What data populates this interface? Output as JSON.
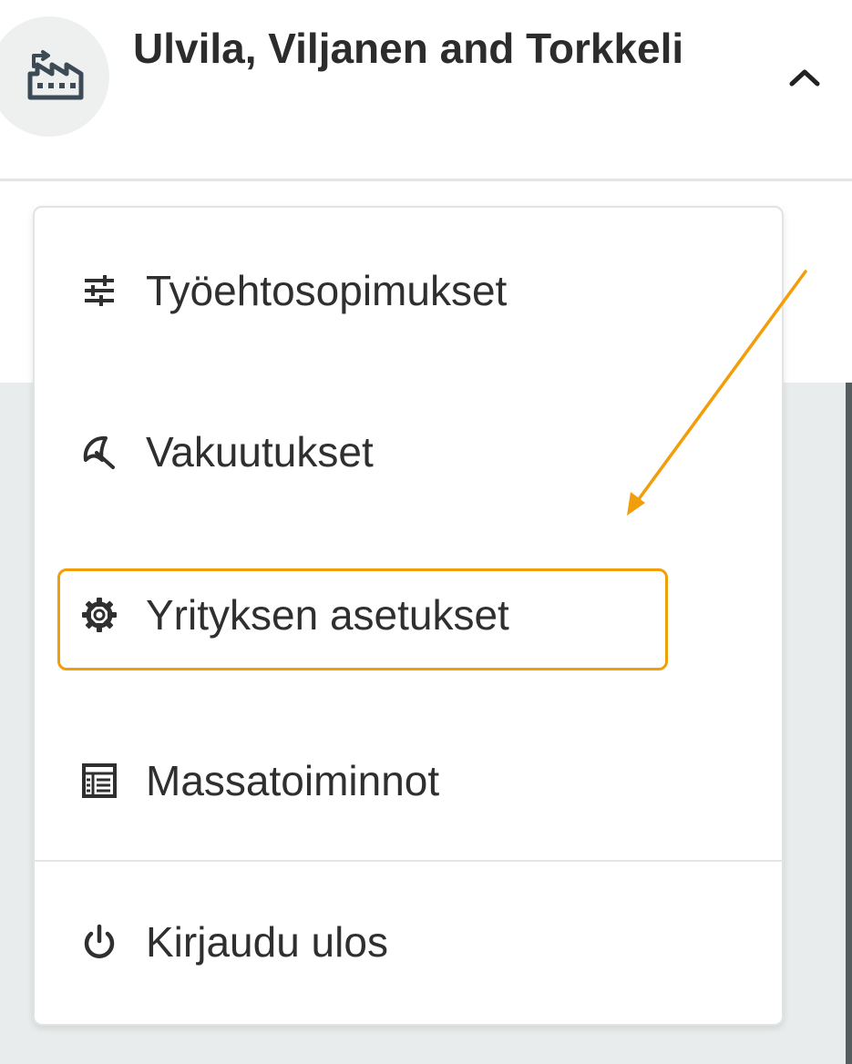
{
  "header": {
    "company_name": "Ulvila, Viljanen and Torkkeli",
    "company_icon": "factory-icon",
    "toggle_icon": "chevron-up-icon"
  },
  "menu": {
    "items": [
      {
        "label": "Työehtosopimukset",
        "icon": "sliders-icon"
      },
      {
        "label": "Vakuutukset",
        "icon": "umbrella-icon"
      },
      {
        "label": "Yrityksen asetukset",
        "icon": "gear-icon",
        "highlighted": true
      },
      {
        "label": "Massatoiminnot",
        "icon": "table-icon"
      }
    ],
    "logout": {
      "label": "Kirjaudu ulos",
      "icon": "power-icon"
    }
  },
  "annotation": {
    "color": "#f29d0a",
    "target": "Yrityksen asetukset"
  }
}
